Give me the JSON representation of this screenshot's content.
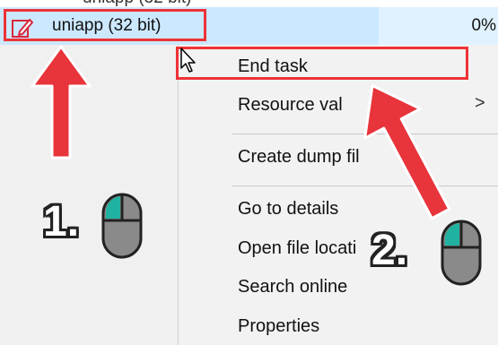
{
  "top_partial_text": "uniapp (32 bit)",
  "process_row": {
    "name": "uniapp (32 bit)",
    "cpu": "0%"
  },
  "context_menu": {
    "items": [
      {
        "label": "End task"
      },
      {
        "label": "Resource val"
      },
      {
        "label": "Create dump fil"
      },
      {
        "label": "Go to details"
      },
      {
        "label": "Open file locati"
      },
      {
        "label": "Search online"
      },
      {
        "label": "Properties"
      }
    ],
    "submenu_chevron": ">"
  },
  "annotations": {
    "step1": "1.",
    "step2": "2.",
    "highlight_color": "#ee3236",
    "arrow_color": "#e8343b",
    "mouse_accent": "#20b2a0"
  }
}
